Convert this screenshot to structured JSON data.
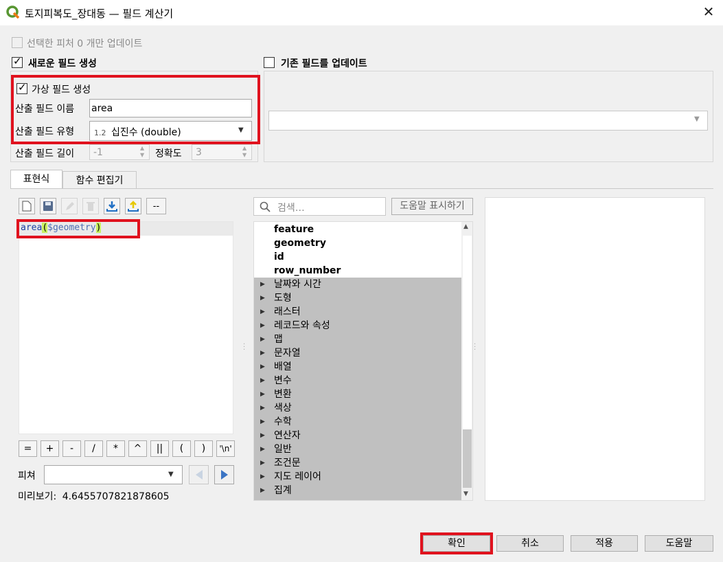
{
  "window": {
    "title": "토지피복도_장대동 — 필드 계산기",
    "close_icon": "close-icon"
  },
  "options": {
    "update_selected_label": "선택한 피처 0 개만 업데이트",
    "create_new_field_label": "새로운 필드 생성",
    "update_existing_label": "기존 필드를 업데이트",
    "virtual_field_label": "가상 필드 생성",
    "field_name_label": "산출 필드 이름",
    "field_name_value": "area",
    "field_type_label": "산출 필드 유형",
    "field_type_prefix": "1.2",
    "field_type_value": "십진수 (double)",
    "field_length_label": "산출 필드 길이",
    "field_length_value": "-1",
    "precision_label": "정확도",
    "precision_value": "3"
  },
  "tabs": [
    "표현식",
    "함수 편집기"
  ],
  "expression": {
    "fn": "area",
    "open": "(",
    "arg": "$geometry",
    "close": ")"
  },
  "operators": [
    "=",
    "+",
    "-",
    "/",
    "*",
    "^",
    "||",
    "(",
    ")",
    "'\\n'"
  ],
  "feature_label": "피쳐",
  "preview": {
    "label": "미리보기:",
    "value": "4.6455707821878605"
  },
  "search": {
    "placeholder": "검색…",
    "show_help_label": "도움말 표시하기"
  },
  "tree": {
    "fields": [
      "feature",
      "geometry",
      "id",
      "row_number"
    ],
    "groups": [
      "날짜와 시간",
      "도형",
      "래스터",
      "레코드와 속성",
      "맵",
      "문자열",
      "배열",
      "변수",
      "변환",
      "색상",
      "수학",
      "연산자",
      "일반",
      "조건문",
      "지도 레이어",
      "집계"
    ]
  },
  "buttons": {
    "ok": "확인",
    "cancel": "취소",
    "apply": "적용",
    "help": "도움말"
  },
  "colors": {
    "highlight_red": "#e0121e",
    "tree_group_bg": "#c0c0c0",
    "expr_fn": "#1a3fa3",
    "paren_bg": "#c8f060"
  }
}
